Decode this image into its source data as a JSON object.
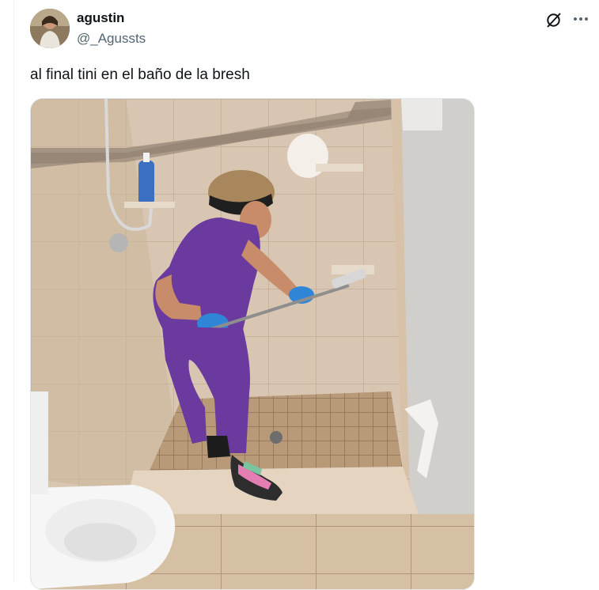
{
  "tweet": {
    "author_name": "agustin",
    "author_handle": "@_Agussts",
    "text": "al final tini en el baño de la bresh"
  },
  "icons": {
    "grok": "grok-icon",
    "more": "more-options-icon"
  },
  "colors": {
    "text": "#0f1419",
    "secondary": "#536471",
    "scrubs": "#6b3a9e",
    "gloves": "#2f86d6"
  }
}
